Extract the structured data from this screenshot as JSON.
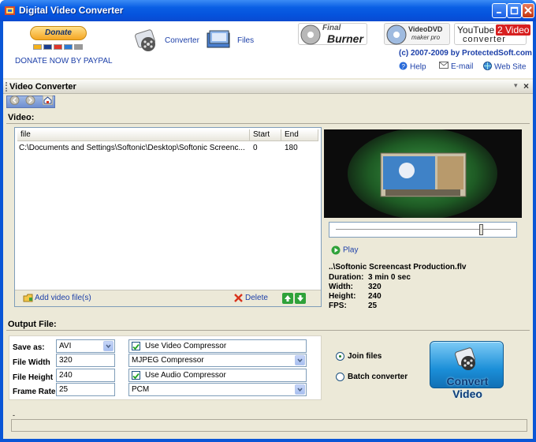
{
  "window": {
    "title": "Digital Video Converter"
  },
  "header": {
    "donate_button": "Donate",
    "donate_text": "DONATE NOW BY PAYPAL",
    "nav": [
      {
        "label": "Converter"
      },
      {
        "label": "Files"
      }
    ],
    "logos": [
      {
        "line1": "Final",
        "line2": "Burner"
      },
      {
        "line1": "VideoDVD",
        "line2": "maker pro"
      },
      {
        "line1": "YouTube",
        "line2": "2",
        "line3": "Video",
        "line4": "converter"
      }
    ],
    "copyright": "(c) 2007-2009 by ProtectedSoft.com",
    "links": [
      {
        "label": "Help"
      },
      {
        "label": "E-mail"
      },
      {
        "label": "Web Site"
      }
    ]
  },
  "panel": {
    "title": "Video Converter"
  },
  "video": {
    "section_label": "Video:",
    "columns": [
      "file",
      "Start",
      "End"
    ],
    "rows": [
      {
        "file": "C:\\Documents and Settings\\Softonic\\Desktop\\Softonic Screenc...",
        "start": "0",
        "end": "180"
      }
    ],
    "add_label": "Add video file(s)",
    "delete_label": "Delete"
  },
  "preview": {
    "play_label": "Play",
    "slider_position": 0.83,
    "filename": "..\\Softonic Screencast Production.flv",
    "fields": [
      {
        "label": "Duration:",
        "value": "3 min 0 sec"
      },
      {
        "label": "Width:",
        "value": "320"
      },
      {
        "label": "Height:",
        "value": "240"
      },
      {
        "label": "FPS:",
        "value": "25"
      }
    ]
  },
  "output": {
    "section_label": "Output File:",
    "save_as_label": "Save as:",
    "save_as_value": "AVI",
    "width_label": "File Width",
    "width_value": "320",
    "height_label": "File Height",
    "height_value": "240",
    "framerate_label": "Frame Rate",
    "framerate_value": "25",
    "video_compressor_check": "Use Video Compressor",
    "video_compressor_value": "MJPEG Compressor",
    "audio_compressor_check": "Use Audio Compressor",
    "audio_compressor_value": "PCM",
    "join_label": "Join files",
    "batch_label": "Batch converter",
    "convert_label": "Convert Video"
  },
  "status": {
    "text": "-"
  },
  "colors": {
    "accent": "#1c3fa8",
    "titlebar": "#0a5fe4",
    "panel_bg": "#ece9d8"
  }
}
